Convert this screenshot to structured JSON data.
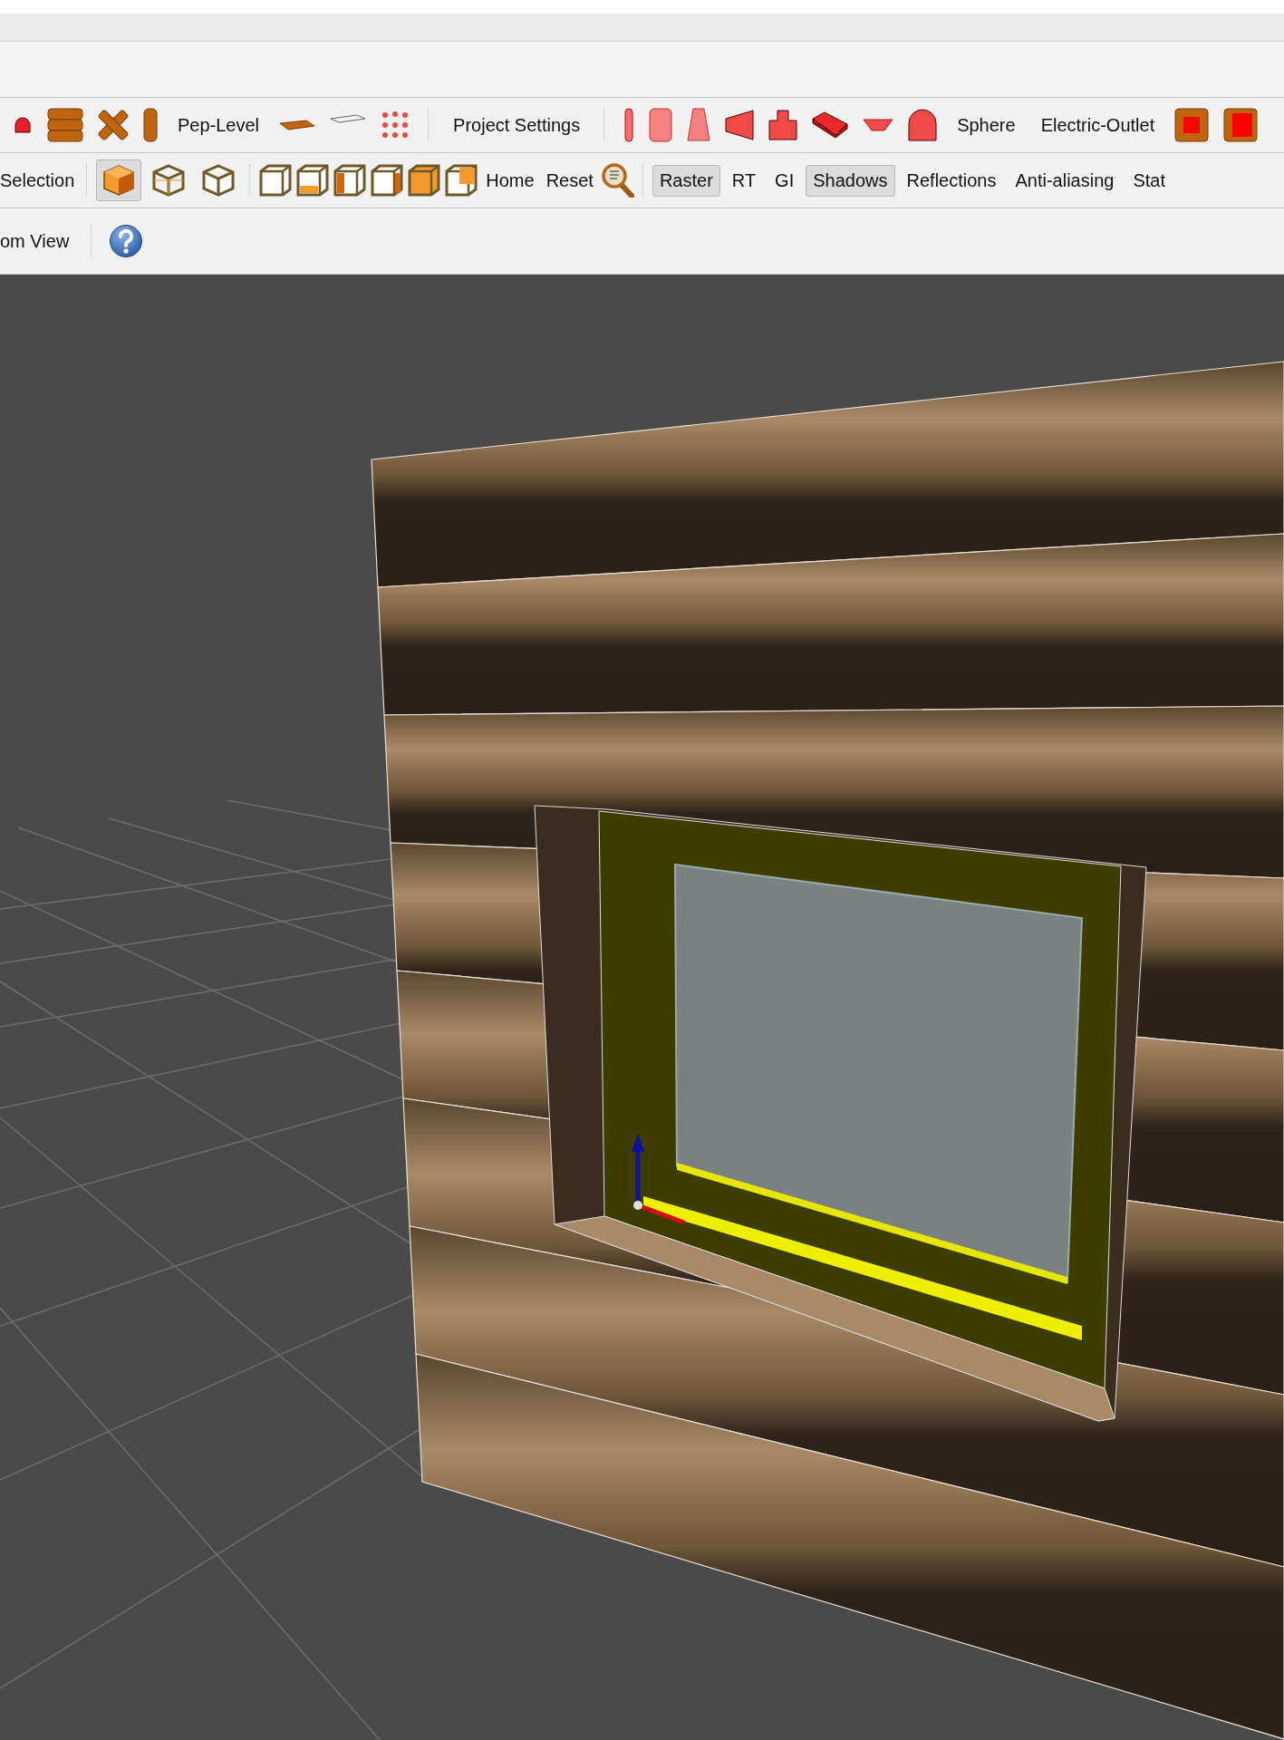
{
  "toolbar": {
    "row_1": {
      "labels": [
        "Pep-Level",
        "Project Settings",
        "Sphere",
        "Electric-Outlet"
      ]
    },
    "row_2": {
      "selection_label": "Selection",
      "view_modes": [
        {
          "selected": true
        },
        {
          "selected": false
        },
        {
          "selected": false
        }
      ],
      "home": "Home",
      "reset": "Reset",
      "render_modes": [
        {
          "label": "Raster",
          "selected": true
        },
        {
          "label": "RT",
          "selected": false
        },
        {
          "label": "GI",
          "selected": false
        }
      ],
      "toggles": [
        {
          "label": "Shadows",
          "on": true
        },
        {
          "label": "Reflections",
          "on": false
        },
        {
          "label": "Anti-aliasing",
          "on": false
        },
        {
          "label": "Stat",
          "on": false
        }
      ]
    },
    "row_3": {
      "label": "om View"
    }
  }
}
